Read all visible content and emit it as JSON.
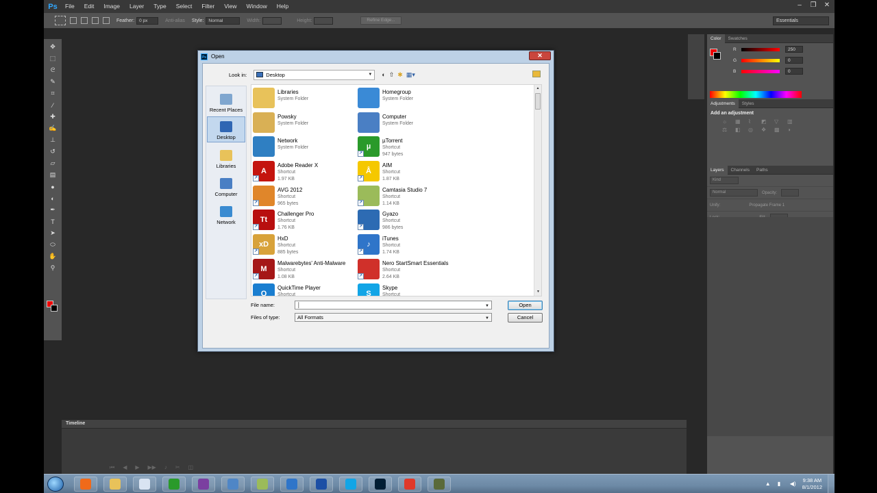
{
  "app": {
    "logo": "Ps",
    "menu": [
      "File",
      "Edit",
      "Image",
      "Layer",
      "Type",
      "Select",
      "Filter",
      "View",
      "Window",
      "Help"
    ],
    "workspace": "Essentials"
  },
  "options_bar": {
    "feather_label": "Feather:",
    "feather_value": "0 px",
    "antialias_label": "Anti-alias",
    "style_label": "Style:",
    "style_value": "Normal",
    "width_label": "Width:",
    "height_label": "Height:",
    "refine_edge": "Refine Edge..."
  },
  "timeline": {
    "tab": "Timeline"
  },
  "panels": {
    "color_tabs": [
      "Color",
      "Swatches"
    ],
    "color": {
      "r_label": "R",
      "g_label": "G",
      "b_label": "B",
      "r": "250",
      "g": "0",
      "b": "0",
      "fg": "#ee0000",
      "bg": "#000000"
    },
    "adjust_tabs": [
      "Adjustments",
      "Styles"
    ],
    "adjust_title": "Add an adjustment",
    "layers_tabs": [
      "Layers",
      "Channels",
      "Paths"
    ],
    "layers": {
      "kind": "Kind",
      "blend": "Normal",
      "opacity": "Opacity:",
      "unify": "Unify:",
      "propagate": "Propagate Frame 1",
      "lock": "Lock:",
      "fill": "Fill:"
    }
  },
  "dialog": {
    "title": "Open",
    "look_in_label": "Look in:",
    "look_in_value": "Desktop",
    "places": [
      {
        "label": "Recent Places",
        "icon": "recent-places-icon",
        "color": "#7fa6cf"
      },
      {
        "label": "Desktop",
        "icon": "desktop-icon",
        "color": "#2f66b3"
      },
      {
        "label": "Libraries",
        "icon": "libraries-icon",
        "color": "#e8c25a"
      },
      {
        "label": "Computer",
        "icon": "computer-icon",
        "color": "#4a7fc4"
      },
      {
        "label": "Network",
        "icon": "network-icon",
        "color": "#3a8bd1"
      }
    ],
    "files": [
      {
        "name": "Libraries",
        "sub1": "System Folder",
        "sub2": "",
        "icon": "libraries-folder-icon",
        "color": "#e8c25a",
        "glyph": "",
        "shortcut": false
      },
      {
        "name": "Homegroup",
        "sub1": "System Folder",
        "sub2": "",
        "icon": "homegroup-icon",
        "color": "#3a8ad6",
        "glyph": "",
        "shortcut": false
      },
      {
        "name": "Powsky",
        "sub1": "System Folder",
        "sub2": "",
        "icon": "user-folder-icon",
        "color": "#d9b055",
        "glyph": "",
        "shortcut": false
      },
      {
        "name": "Computer",
        "sub1": "System Folder",
        "sub2": "",
        "icon": "computer-icon",
        "color": "#4a7fc4",
        "glyph": "",
        "shortcut": false
      },
      {
        "name": "Network",
        "sub1": "System Folder",
        "sub2": "",
        "icon": "network-icon",
        "color": "#2f7fc2",
        "glyph": "",
        "shortcut": false
      },
      {
        "name": "µTorrent",
        "sub1": "Shortcut",
        "sub2": "947 bytes",
        "icon": "utorrent-icon",
        "color": "#2a9a2a",
        "glyph": "µ",
        "shortcut": true
      },
      {
        "name": "Adobe Reader X",
        "sub1": "Shortcut",
        "sub2": "1.97 KB",
        "icon": "adobe-reader-icon",
        "color": "#c4140e",
        "glyph": "A",
        "shortcut": true
      },
      {
        "name": "AIM",
        "sub1": "Shortcut",
        "sub2": "1.87 KB",
        "icon": "aim-icon",
        "color": "#f5c800",
        "glyph": "Å",
        "shortcut": true
      },
      {
        "name": "AVG 2012",
        "sub1": "Shortcut",
        "sub2": "965 bytes",
        "icon": "avg-icon",
        "color": "#e0862a",
        "glyph": "",
        "shortcut": true
      },
      {
        "name": "Camtasia Studio 7",
        "sub1": "Shortcut",
        "sub2": "1.14 KB",
        "icon": "camtasia-icon",
        "color": "#9bbb5a",
        "glyph": "",
        "shortcut": true
      },
      {
        "name": "Challenger Pro",
        "sub1": "Shortcut",
        "sub2": "1.76 KB",
        "icon": "challenger-pro-icon",
        "color": "#b80f0f",
        "glyph": "Tt",
        "shortcut": true
      },
      {
        "name": "Gyazo",
        "sub1": "Shortcut",
        "sub2": "986 bytes",
        "icon": "gyazo-icon",
        "color": "#2d6bb3",
        "glyph": "",
        "shortcut": true
      },
      {
        "name": "HxD",
        "sub1": "Shortcut",
        "sub2": "885 bytes",
        "icon": "hxd-icon",
        "color": "#d8a23a",
        "glyph": "xD",
        "shortcut": true
      },
      {
        "name": "iTunes",
        "sub1": "Shortcut",
        "sub2": "1.74 KB",
        "icon": "itunes-icon",
        "color": "#2f75c9",
        "glyph": "♪",
        "shortcut": true
      },
      {
        "name": "Malwarebytes' Anti-Malware",
        "sub1": "Shortcut",
        "sub2": "1.08 KB",
        "icon": "malwarebytes-icon",
        "color": "#a51717",
        "glyph": "M",
        "shortcut": true
      },
      {
        "name": "Nero StartSmart Essentials",
        "sub1": "Shortcut",
        "sub2": "2.64 KB",
        "icon": "nero-icon",
        "color": "#d0302a",
        "glyph": "",
        "shortcut": true
      },
      {
        "name": "QuickTime Player",
        "sub1": "Shortcut",
        "sub2": "",
        "icon": "quicktime-icon",
        "color": "#1a7ed0",
        "glyph": "Q",
        "shortcut": true
      },
      {
        "name": "Skype",
        "sub1": "Shortcut",
        "sub2": "",
        "icon": "skype-icon",
        "color": "#12a5e6",
        "glyph": "S",
        "shortcut": true
      }
    ],
    "file_name_label": "File name:",
    "file_name_value": "",
    "files_of_type_label": "Files of type:",
    "files_of_type_value": "All Formats",
    "open_button": "Open",
    "cancel_button": "Cancel"
  },
  "taskbar": {
    "apps": [
      {
        "icon": "media-center-icon",
        "color": "#f06a1a"
      },
      {
        "icon": "explorer-folder-icon",
        "color": "#e8c25a"
      },
      {
        "icon": "document-icon",
        "color": "#d9e4f2"
      },
      {
        "icon": "utorrent-icon",
        "color": "#2a9a2a"
      },
      {
        "icon": "winrar-icon",
        "color": "#7b3fa0"
      },
      {
        "icon": "screen-capture-icon",
        "color": "#4f86c6"
      },
      {
        "icon": "camtasia-icon",
        "color": "#9bbb5a"
      },
      {
        "icon": "itunes-icon",
        "color": "#2f75c9"
      },
      {
        "icon": "globe-icon",
        "color": "#1c4fa5"
      },
      {
        "icon": "skype-icon",
        "color": "#12a5e6"
      },
      {
        "icon": "photoshop-icon",
        "color": "#001d34"
      },
      {
        "icon": "chrome-icon",
        "color": "#e0392b"
      },
      {
        "icon": "game-icon",
        "color": "#5a6a3a"
      }
    ],
    "time": "9:38 AM",
    "date": "8/1/2012"
  }
}
